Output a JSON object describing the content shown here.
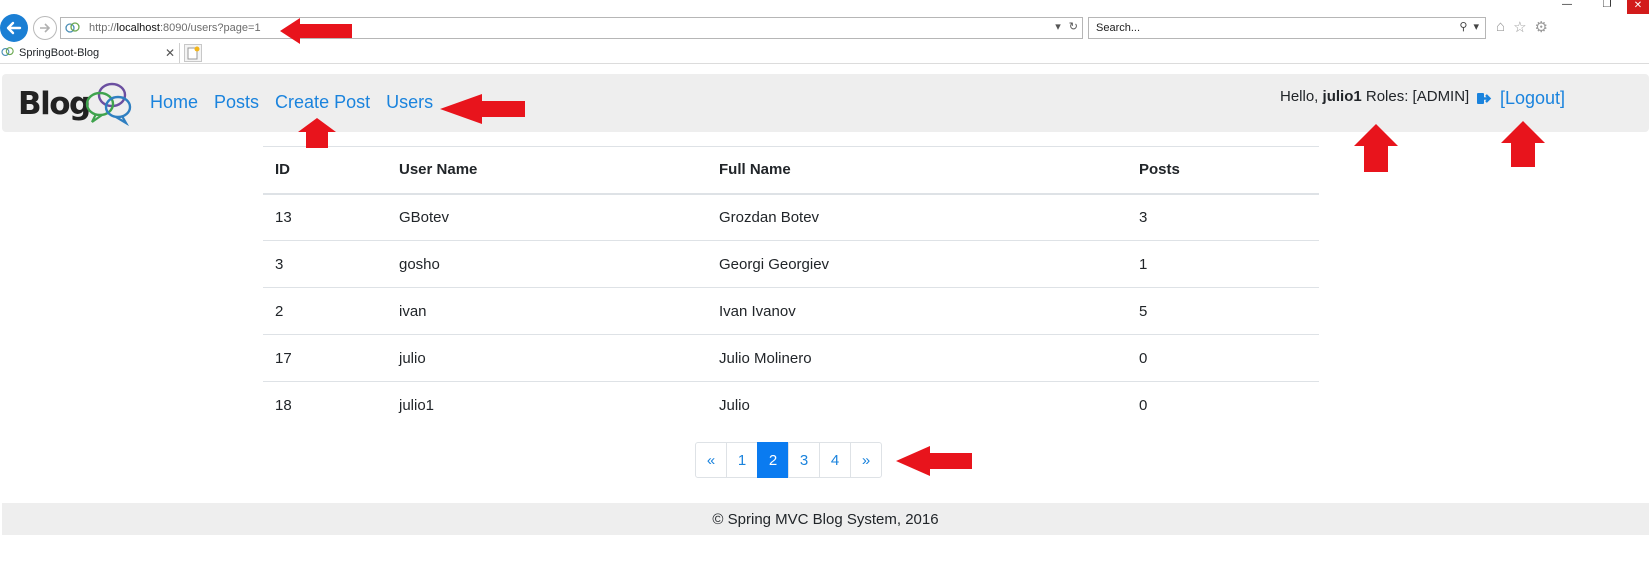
{
  "browser": {
    "url_prefix": "http://",
    "url_host": "localhost",
    "url_rest": ":8090/users?page=1",
    "search_placeholder": "Search...",
    "tab_title": "SpringBoot-Blog"
  },
  "navbar": {
    "brand": "Blog",
    "links": [
      "Home",
      "Posts",
      "Create Post",
      "Users"
    ],
    "hello": "Hello,",
    "username": "julio1",
    "roles": "Roles: [ADMIN]",
    "logout": "[Logout]"
  },
  "table": {
    "headers": [
      "ID",
      "User Name",
      "Full Name",
      "Posts"
    ],
    "rows": [
      [
        "13",
        "GBotev",
        "Grozdan Botev",
        "3"
      ],
      [
        "3",
        "gosho",
        "Georgi Georgiev",
        "1"
      ],
      [
        "2",
        "ivan",
        "Ivan Ivanov",
        "5"
      ],
      [
        "17",
        "julio",
        "Julio Molinero",
        "0"
      ],
      [
        "18",
        "julio1",
        "Julio",
        "0"
      ]
    ]
  },
  "pagination": {
    "prev": "«",
    "pages": [
      "1",
      "2",
      "3",
      "4"
    ],
    "active": "2",
    "next": "»"
  },
  "footer": {
    "text": "© Spring MVC Blog System, 2016"
  },
  "colors": {
    "link": "#1a83dd",
    "active_page": "#0a7bf0",
    "annotation_arrow": "#e8141c"
  }
}
